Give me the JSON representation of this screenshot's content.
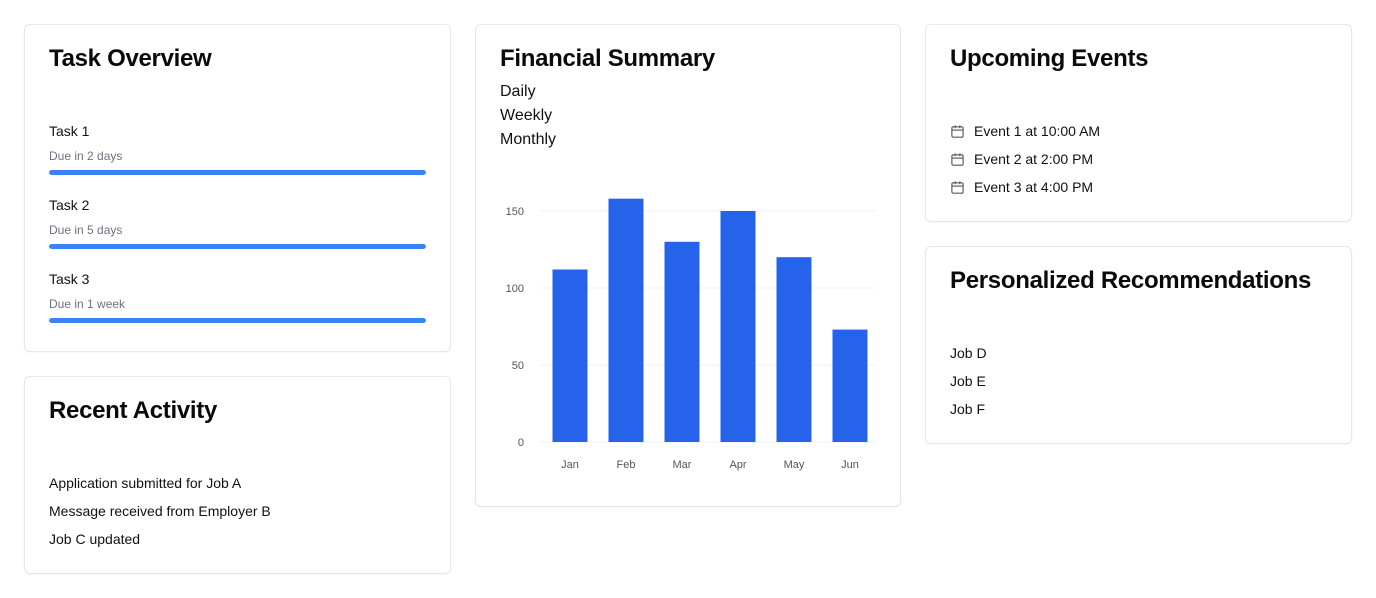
{
  "task_overview": {
    "title": "Task Overview",
    "tasks": [
      {
        "name": "Task 1",
        "due": "Due in 2 days",
        "progress": 1.0
      },
      {
        "name": "Task 2",
        "due": "Due in 5 days",
        "progress": 1.0
      },
      {
        "name": "Task 3",
        "due": "Due in 1 week",
        "progress": 1.0
      }
    ]
  },
  "recent_activity": {
    "title": "Recent Activity",
    "items": [
      "Application submitted for Job A",
      "Message received from Employer B",
      "Job C updated"
    ]
  },
  "financial_summary": {
    "title": "Financial Summary",
    "periods": [
      "Daily",
      "Weekly",
      "Monthly"
    ]
  },
  "upcoming_events": {
    "title": "Upcoming Events",
    "icon": "calendar-icon",
    "events": [
      "Event 1 at 10:00 AM",
      "Event 2 at 2:00 PM",
      "Event 3 at 4:00 PM"
    ]
  },
  "recommendations": {
    "title": "Personalized Recommendations",
    "items": [
      "Job D",
      "Job E",
      "Job F"
    ]
  },
  "colors": {
    "accent": "#3b82f6",
    "bar": "#2563eb"
  },
  "chart_data": {
    "type": "bar",
    "categories": [
      "Jan",
      "Feb",
      "Mar",
      "Apr",
      "May",
      "Jun"
    ],
    "values": [
      112,
      158,
      130,
      150,
      120,
      73
    ],
    "ylim": [
      0,
      150
    ],
    "yticks": [
      0,
      50,
      100,
      150
    ],
    "grid": true,
    "title": "",
    "xlabel": "",
    "ylabel": ""
  }
}
